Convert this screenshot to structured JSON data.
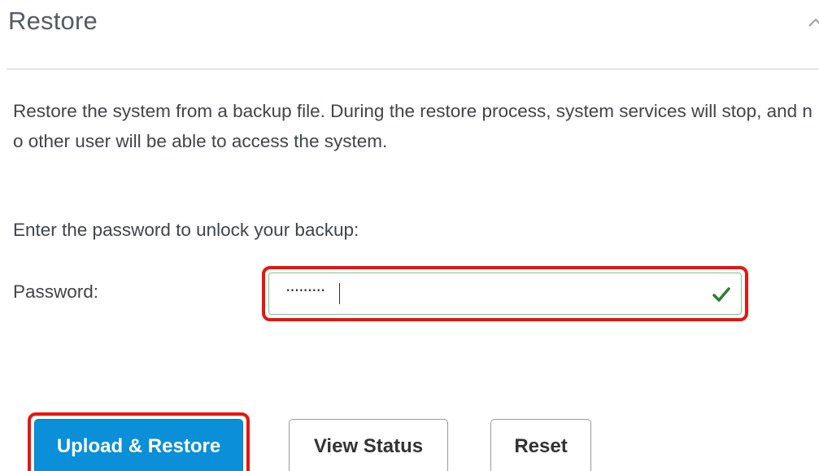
{
  "panel": {
    "title": "Restore",
    "collapse_icon": "chevron-up-icon"
  },
  "description": "Restore the system from a backup file. During the restore process, system services will stop, and no other user will be able to access the system.",
  "form": {
    "unlock_label": "Enter the password to unlock your backup:",
    "password_label": "Password:",
    "password_value": "·········",
    "validation_icon": "checkmark-icon",
    "validation_color": "#2e7d32"
  },
  "buttons": {
    "upload_restore": "Upload & Restore",
    "view_status": "View Status",
    "reset": "Reset"
  },
  "colors": {
    "primary": "#0a8fd8",
    "highlight": "#e8150e"
  }
}
